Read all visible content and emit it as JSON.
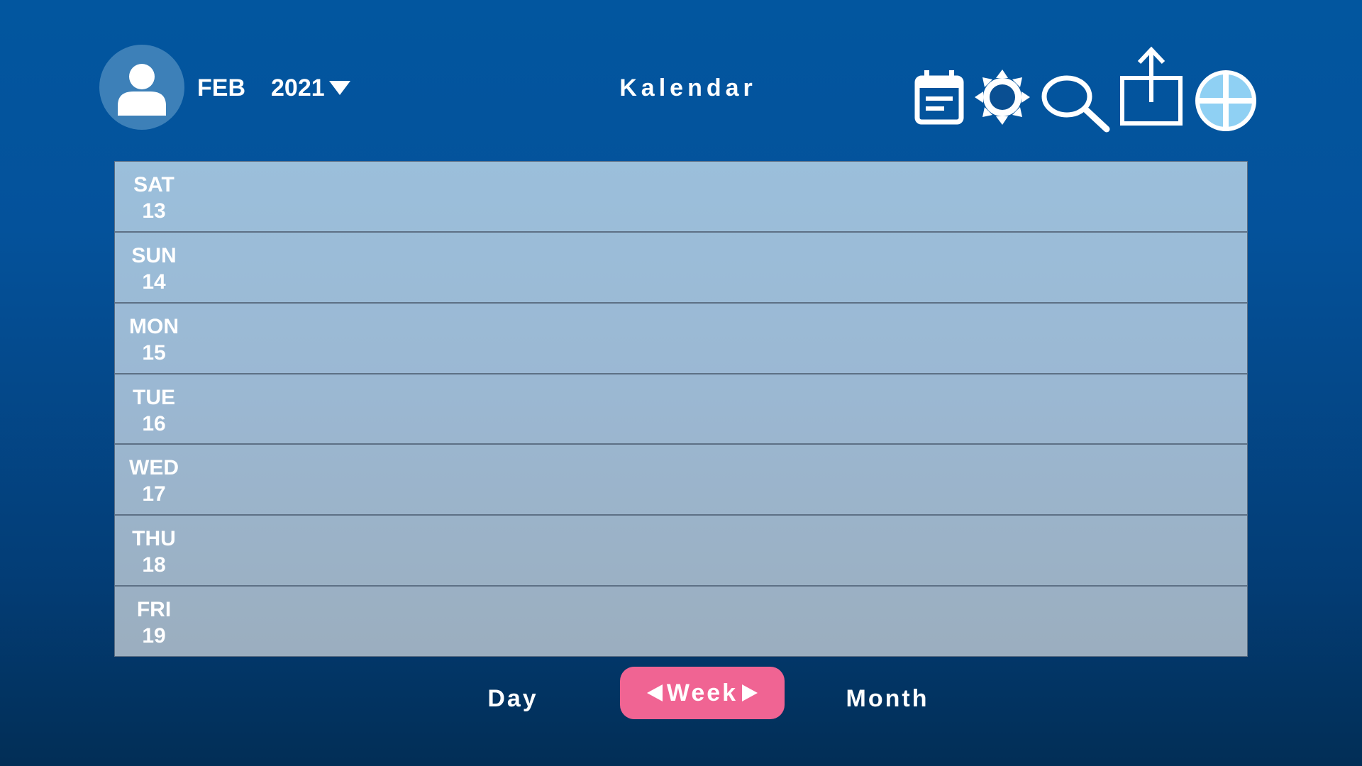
{
  "header": {
    "month": "FEB",
    "year": "2021",
    "title": "Kalendar"
  },
  "toolbar": {
    "icons": [
      "calendar-icon",
      "settings-gear-icon",
      "search-icon",
      "share-export-icon",
      "add-plus-icon"
    ]
  },
  "days": [
    {
      "weekday": "SAT",
      "date": "13"
    },
    {
      "weekday": "SUN",
      "date": "14"
    },
    {
      "weekday": "MON",
      "date": "15"
    },
    {
      "weekday": "TUE",
      "date": "16"
    },
    {
      "weekday": "WED",
      "date": "17"
    },
    {
      "weekday": "THU",
      "date": "18"
    },
    {
      "weekday": "FRI",
      "date": "19"
    }
  ],
  "view_switcher": {
    "day_label": "Day",
    "week_label": "Week",
    "month_label": "Month",
    "active": "Week"
  },
  "colors": {
    "background_top": "#02569f",
    "background_bottom": "#022e56",
    "row_fill": "#9bbfdb",
    "active_tab": "#f06493",
    "avatar_circle": "#3d80b8",
    "add_button_fill": "#8fd0f3"
  }
}
